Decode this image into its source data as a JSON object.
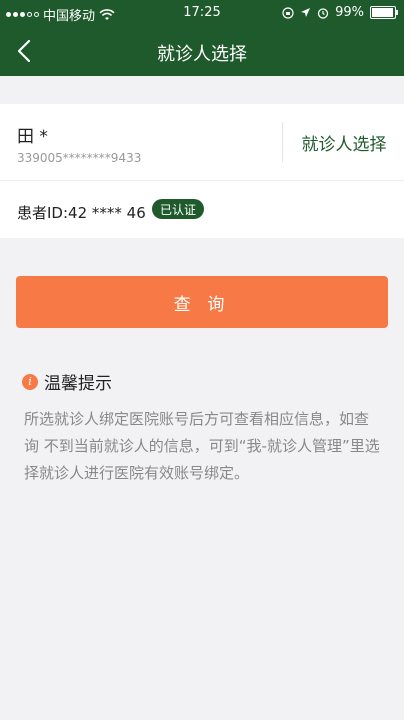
{
  "status_bar": {
    "carrier": "中国移动",
    "time": "17:25",
    "battery": "99%"
  },
  "nav": {
    "title": "就诊人选择"
  },
  "patient": {
    "name": "田 *",
    "id_number": "339005********9433",
    "select_label": "就诊人选择",
    "patient_id": "患者ID:42 **** 46",
    "verified_label": "已认证"
  },
  "query_button": {
    "label": "查 询"
  },
  "tips": {
    "title": "温馨提示",
    "body": "所选就诊人绑定医院账号后方可查看相应信息，如查询 不到当前就诊人的信息，可到“我-就诊人管理”里选择就诊人进行医院有效账号绑定。"
  },
  "icons": {
    "back": "back-arrow-icon",
    "info": "info-icon"
  },
  "colors": {
    "brand": "#1f5a2c",
    "accent": "#f77a46"
  }
}
